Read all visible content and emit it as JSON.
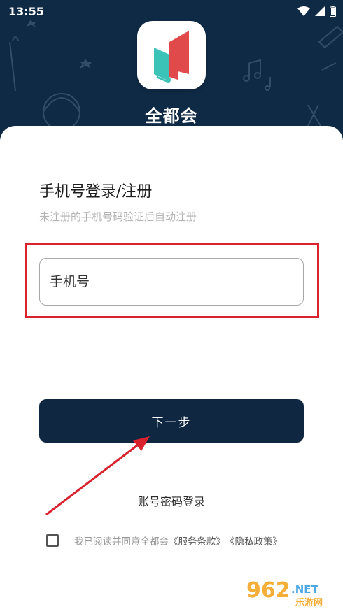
{
  "status_bar": {
    "time": "13:55"
  },
  "app": {
    "name": "全都会"
  },
  "login": {
    "title": "手机号登录/注册",
    "subtitle": "未注册的手机号码验证后自动注册",
    "phone_placeholder": "手机号",
    "next_label": "下一步",
    "password_login": "账号密码登录"
  },
  "agreement": {
    "prefix": "我已阅读并同意全都会",
    "terms": "《服务条款》",
    "privacy": "《隐私政策》"
  },
  "watermark": {
    "brand": "962",
    "net": ".NET",
    "sub": "乐游网"
  },
  "colors": {
    "header": "#0f2a45",
    "button": "#0f2740",
    "highlight": "#d8232f",
    "logo_red": "#e04a4a",
    "logo_teal": "#3cc3b8"
  }
}
